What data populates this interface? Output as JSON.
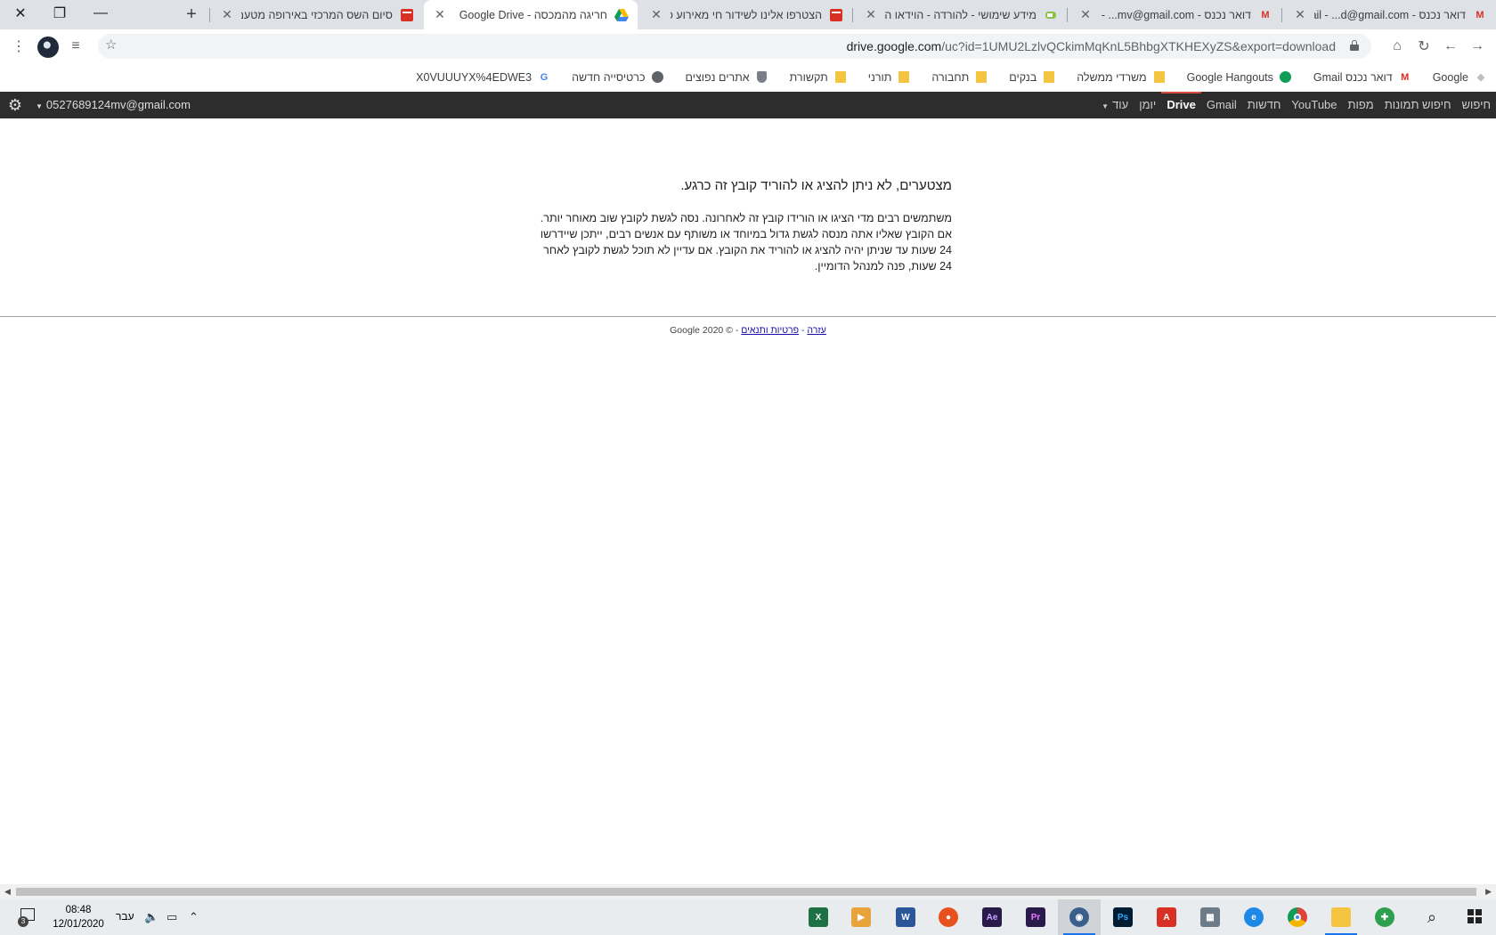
{
  "window": {
    "close_glyph": "✕",
    "restore_glyph": "❐",
    "minimize_glyph": "—"
  },
  "tabs": [
    {
      "title": "דואר נכנס - Gmail - ...d@gmail.com",
      "icon": "gmail-icon"
    },
    {
      "title": "דואר נכנס - Gmail - ...mv@gmail.com",
      "icon": "gmail-icon"
    },
    {
      "title": "מידע שימושי - להורדה - הוידאו הכ",
      "icon": "thermometer-icon"
    },
    {
      "title": "הצטרפו אלינו לשידור חי מאירוע כ",
      "icon": "video-icon"
    },
    {
      "title": "חריגה מהמכסה - Google Drive",
      "icon": "google-drive-icon",
      "active": true
    },
    {
      "title": "סיום השס המרכזי באירופה מטעם",
      "icon": "video-icon"
    }
  ],
  "new_tab_glyph": "+",
  "close_tab_glyph": "✕",
  "omnibox": {
    "url_host": "drive.google.com",
    "url_rest": "/uc?id=1UMU2LzlvQCkimMqKnL5BhbgXTKHEXyZS&export=download"
  },
  "bookmarks": [
    {
      "label": "Google",
      "icon": "google-faded-icon"
    },
    {
      "label": "דואר נכנס Gmail",
      "icon": "gmail-icon"
    },
    {
      "label": "Google Hangouts",
      "icon": "hangouts-icon"
    },
    {
      "label": "משרדי ממשלה",
      "icon": "folder-icon"
    },
    {
      "label": "בנקים",
      "icon": "folder-icon"
    },
    {
      "label": "תחבורה",
      "icon": "folder-icon"
    },
    {
      "label": "תורני",
      "icon": "folder-icon"
    },
    {
      "label": "תקשורת",
      "icon": "folder-icon"
    },
    {
      "label": "אתרים נפוצים",
      "icon": "shield-icon"
    },
    {
      "label": "כרטיסייה חדשה",
      "icon": "globe-icon"
    },
    {
      "label": "X0VUUUYX%4EDWE3",
      "icon": "google-icon"
    }
  ],
  "gbar": {
    "nav": [
      "חיפוש",
      "חיפוש תמונות",
      "מפות",
      "YouTube",
      "חדשות",
      "Gmail",
      "Drive",
      "יומן",
      "עוד"
    ],
    "active": "Drive",
    "more_label": "עוד",
    "account": "0527689124mv@gmail.com"
  },
  "error": {
    "title": "מצטערים, לא ניתן להציג או להוריד קובץ זה כרגע.",
    "lines": [
      "משתמשים רבים מדי הציגו או הורידו קובץ זה לאחרונה. נסה לגשת לקובץ שוב מאוחר יותר.",
      "אם הקובץ שאליו אתה מנסה לגשת גדול במיוחד או משותף עם אנשים רבים, ייתכן שיידרשו",
      "24 שעות עד שניתן יהיה להציג או להוריד את הקובץ. אם עדיין לא תוכל לגשת לקובץ לאחר",
      "24 שעות, פנה למנהל הדומיין."
    ]
  },
  "footer": {
    "help": "עזרה",
    "sep1": " - ",
    "privacy": "פרטיות ותנאים",
    "sep2": " - ",
    "copyright": "© 2020 Google"
  },
  "taskbar": {
    "time": "08:48",
    "date": "12/01/2020",
    "lang": "עבר",
    "notifications": "3",
    "apps": [
      "excel-icon",
      "media-player-icon",
      "word-icon",
      "burner-icon",
      "after-effects-icon",
      "premiere-icon",
      "browser-icon",
      "photoshop-icon",
      "acrobat-icon",
      "network-icon",
      "edge-icon",
      "chrome-icon",
      "file-explorer-icon",
      "green-app-icon",
      "search-icon",
      "windows-start-icon"
    ]
  },
  "colors": {
    "gbar_bg": "#2d2d2d",
    "active_indicator": "#dd4b39",
    "link": "#1a0dab"
  }
}
